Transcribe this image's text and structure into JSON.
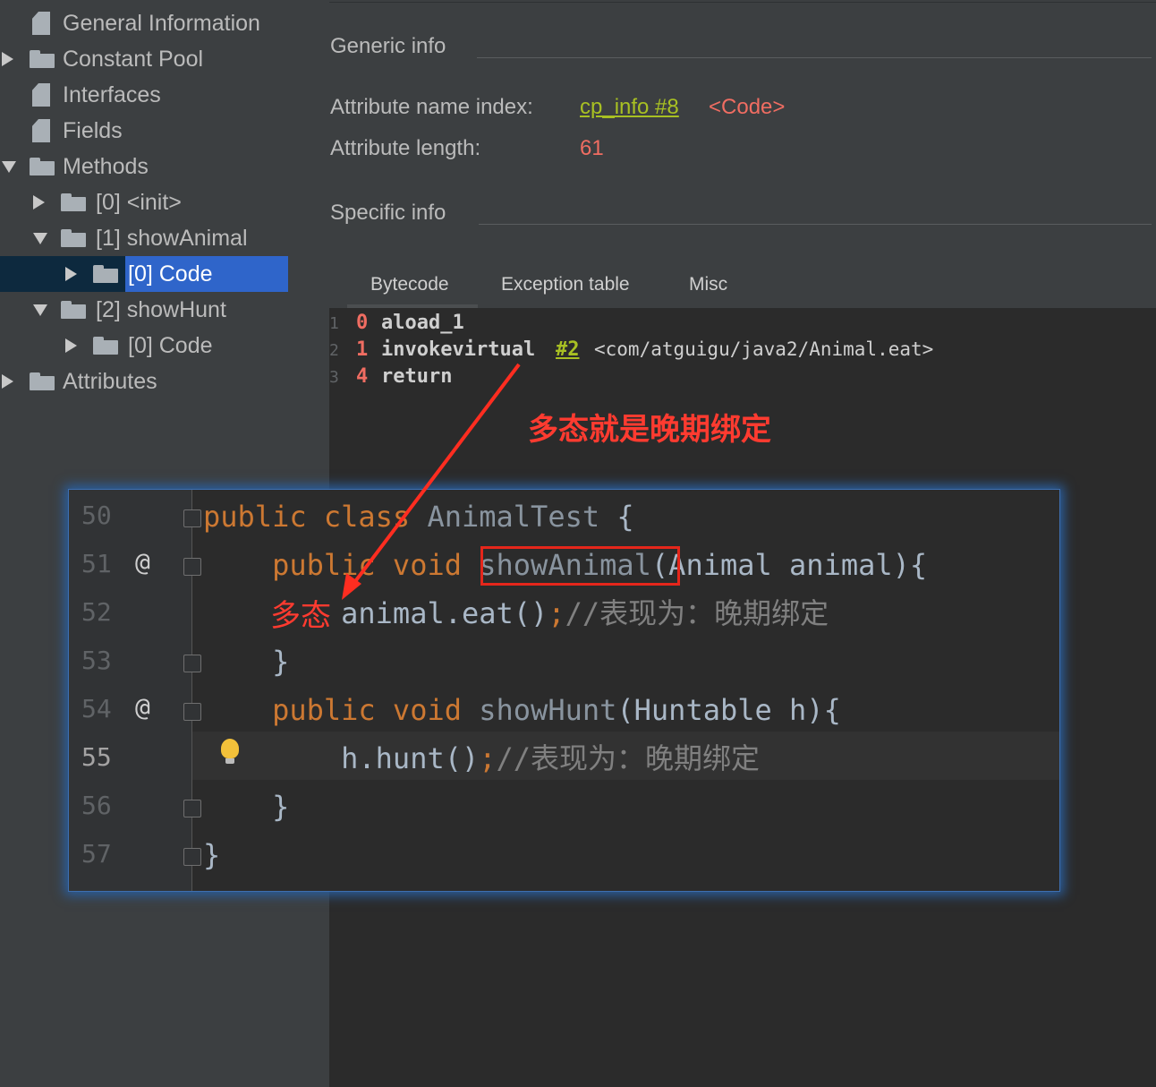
{
  "tree": {
    "items": [
      {
        "label": "General Information",
        "icon": "file-icon"
      },
      {
        "label": "Constant Pool",
        "icon": "folder-icon"
      },
      {
        "label": "Interfaces",
        "icon": "file-icon"
      },
      {
        "label": "Fields",
        "icon": "file-icon"
      },
      {
        "label": "Methods",
        "icon": "folder-icon"
      },
      {
        "label": "[0] <init>",
        "icon": "folder-icon"
      },
      {
        "label": "[1] showAnimal",
        "icon": "folder-icon"
      },
      {
        "label": "[0] Code",
        "icon": "folder-icon",
        "selected": true
      },
      {
        "label": "[2] showHunt",
        "icon": "folder-icon"
      },
      {
        "label": "[0] Code",
        "icon": "folder-icon"
      },
      {
        "label": "Attributes",
        "icon": "folder-icon"
      }
    ]
  },
  "generic": {
    "title": "Generic info",
    "name_index_label": "Attribute name index:",
    "name_index_link": "cp_info #8",
    "name_index_value": "<Code>",
    "length_label": "Attribute length:",
    "length_value": "61"
  },
  "specific": {
    "title": "Specific info",
    "tabs": [
      "Bytecode",
      "Exception table",
      "Misc"
    ],
    "active_tab": "Bytecode"
  },
  "bytecode": [
    {
      "line": "1",
      "offset": "0",
      "op": "aload_1",
      "arg": "",
      "comment": ""
    },
    {
      "line": "2",
      "offset": "1",
      "op": "invokevirtual",
      "arg": "#2",
      "comment": "<com/atguigu/java2/Animal.eat>"
    },
    {
      "line": "3",
      "offset": "4",
      "op": "return",
      "arg": "",
      "comment": ""
    }
  ],
  "annotation": {
    "title": "多态就是晚期绑定",
    "word": "多态",
    "color": "#ff3b30"
  },
  "code": {
    "lines": [
      {
        "num": "50",
        "marker": ""
      },
      {
        "num": "51",
        "marker": "@"
      },
      {
        "num": "52",
        "marker": ""
      },
      {
        "num": "53",
        "marker": ""
      },
      {
        "num": "54",
        "marker": "@"
      },
      {
        "num": "55",
        "marker": ""
      },
      {
        "num": "56",
        "marker": ""
      },
      {
        "num": "57",
        "marker": ""
      }
    ],
    "l50": {
      "kw1": "public",
      "kw2": "class",
      "name": "AnimalTest",
      "rest": "{"
    },
    "l51": {
      "kw1": "public",
      "kw2": "void",
      "name": "showAnimal",
      "rest": "(Animal animal){"
    },
    "l52": {
      "code": "animal.eat()",
      "semi": ";",
      "comment": "//表现为：晚期绑定"
    },
    "l53": {
      "code": "}"
    },
    "l54": {
      "kw1": "public",
      "kw2": "void",
      "name": "showHunt",
      "rest": "(Huntable h){"
    },
    "l55": {
      "code": "h.hunt()",
      "semi": ";",
      "comment": "//表现为：晚期绑定"
    },
    "l56": {
      "code": "}"
    },
    "l57": {
      "code": "}"
    }
  }
}
